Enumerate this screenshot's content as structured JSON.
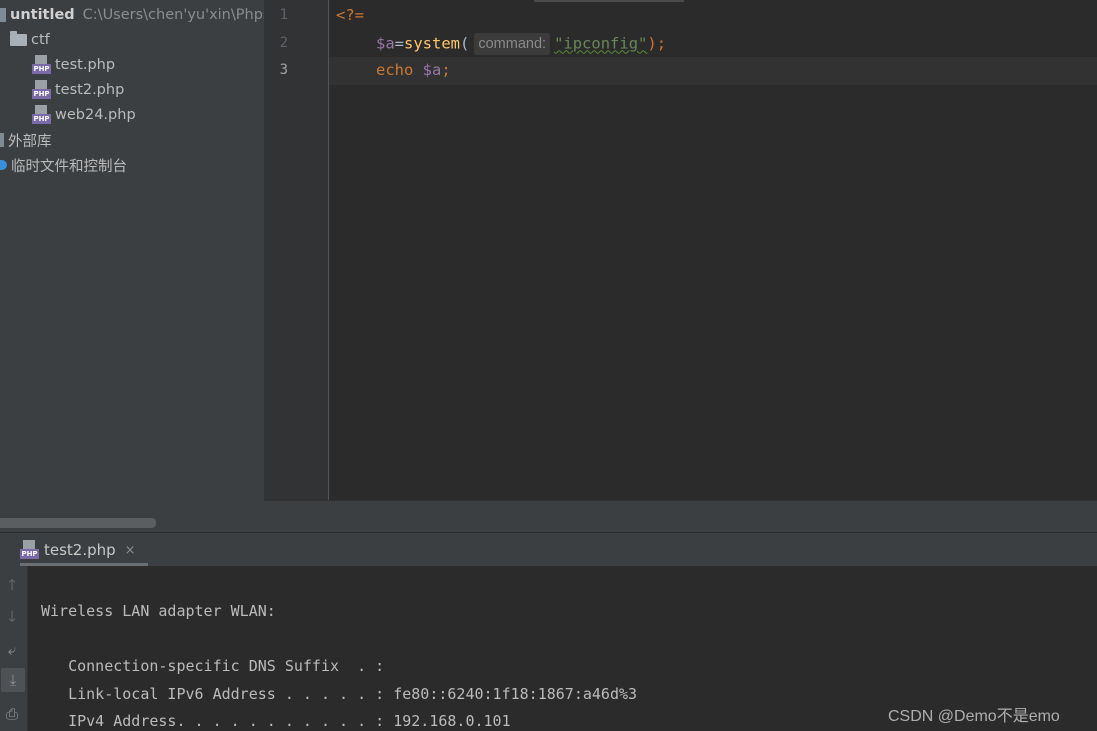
{
  "project": {
    "root_name": "untitled",
    "root_path": "C:\\Users\\chen'yu'xin\\Phps",
    "folder": "ctf",
    "files": [
      "test.php",
      "test2.php",
      "web24.php"
    ],
    "external_libs": "外部库",
    "scratches": "临时文件和控制台",
    "file_icon_tag": "PHP"
  },
  "editor": {
    "line_numbers": [
      "1",
      "2",
      "3"
    ],
    "line1": {
      "open_tag": "<?="
    },
    "line2": {
      "var": "$a",
      "eq": "=",
      "fn": "system",
      "paren_open": "(",
      "hint": "command:",
      "string": "\"ipconfig\"",
      "close": ");"
    },
    "line3": {
      "kw": "echo",
      "var": "$a",
      "semi": ";"
    }
  },
  "run_panel": {
    "tab_label": "test2.php",
    "tab_close": "×",
    "toolbar": {
      "up_icon": "↑",
      "down_icon": "↓",
      "wrap_icon": "⤶",
      "scroll_end_icon": "⤓",
      "print_icon": "⎙"
    },
    "console_lines": [
      "Wireless LAN adapter WLAN:",
      "   Connection-specific DNS Suffix  . :",
      "   Link-local IPv6 Address . . . . . : fe80::6240:1f18:1867:a46d%3",
      "   IPv4 Address. . . . . . . . . . . : 192.168.0.101"
    ]
  },
  "watermark": "CSDN @Demo不是emo"
}
